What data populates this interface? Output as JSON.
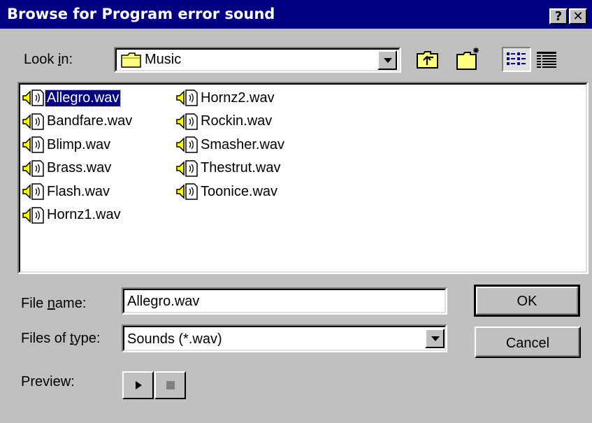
{
  "window": {
    "title": "Browse for Program error sound",
    "help_label": "?",
    "close_label": "✕"
  },
  "look_in": {
    "label_pre": "Look ",
    "label_key": "i",
    "label_post": "n:",
    "value": "Music"
  },
  "toolbar": {
    "icons": [
      "up-one-level-icon",
      "create-new-folder-icon",
      "list-view-icon",
      "details-view-icon"
    ]
  },
  "files": {
    "column1": [
      "Allegro.wav",
      "Bandfare.wav",
      "Blimp.wav",
      "Brass.wav",
      "Flash.wav",
      "Hornz1.wav"
    ],
    "column2": [
      "Hornz2.wav",
      "Rockin.wav",
      "Smasher.wav",
      "Thestrut.wav",
      "Toonice.wav"
    ],
    "selected": "Allegro.wav"
  },
  "file_name": {
    "label_pre": "File ",
    "label_key": "n",
    "label_post": "ame:",
    "value": "Allegro.wav"
  },
  "file_type": {
    "label_pre": "Files of ",
    "label_key": "t",
    "label_post": "ype:",
    "value": "Sounds (*.wav)"
  },
  "preview": {
    "label": "Preview:"
  },
  "buttons": {
    "ok": "OK",
    "cancel": "Cancel"
  },
  "colors": {
    "titlebar": "#000080",
    "face": "#c0c0c0",
    "selection": "#000080"
  }
}
